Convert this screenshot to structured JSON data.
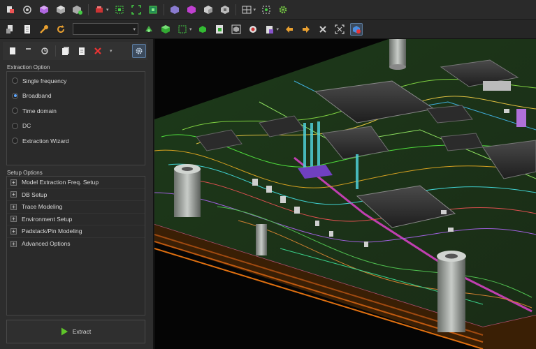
{
  "extraction": {
    "title": "Extraction Option",
    "options": [
      "Single frequency",
      "Broadband",
      "Time domain",
      "DC",
      "Extraction Wizard"
    ],
    "selected": "Broadband"
  },
  "setup": {
    "title": "Setup Options",
    "items": [
      "Model Extraction Freq. Setup",
      "DB Setup",
      "Trace Modeling",
      "Environment Setup",
      "Padstack/Pin Modeling",
      "Advanced Options"
    ]
  },
  "extract_button": {
    "label": "Extract"
  },
  "icons": {
    "toolbar1": [
      "import-icon",
      "layers-icon",
      "cube-purple-icon",
      "cube-gray-icon",
      "cube-export-icon",
      "component-red-icon",
      "select-green-icon",
      "fit-view-icon",
      "zoom-box-icon",
      "cube-violet-icon",
      "cube-magenta-icon",
      "cube-white-icon",
      "cube-tiles-icon",
      "grid-icon",
      "snap-icon",
      "gear-green-icon"
    ],
    "toolbar2": [
      "open-icon",
      "document-icon",
      "wrench-icon",
      "refresh-icon",
      "net-icon",
      "cube-green-icon",
      "select-box-icon",
      "cube-small-icon",
      "cube-page-icon",
      "cube-frame-icon",
      "stop-icon",
      "clipboard-icon",
      "arrow-left-icon",
      "arrow-right-icon",
      "cross-icon",
      "expand-icon",
      "view-3d-icon"
    ]
  }
}
